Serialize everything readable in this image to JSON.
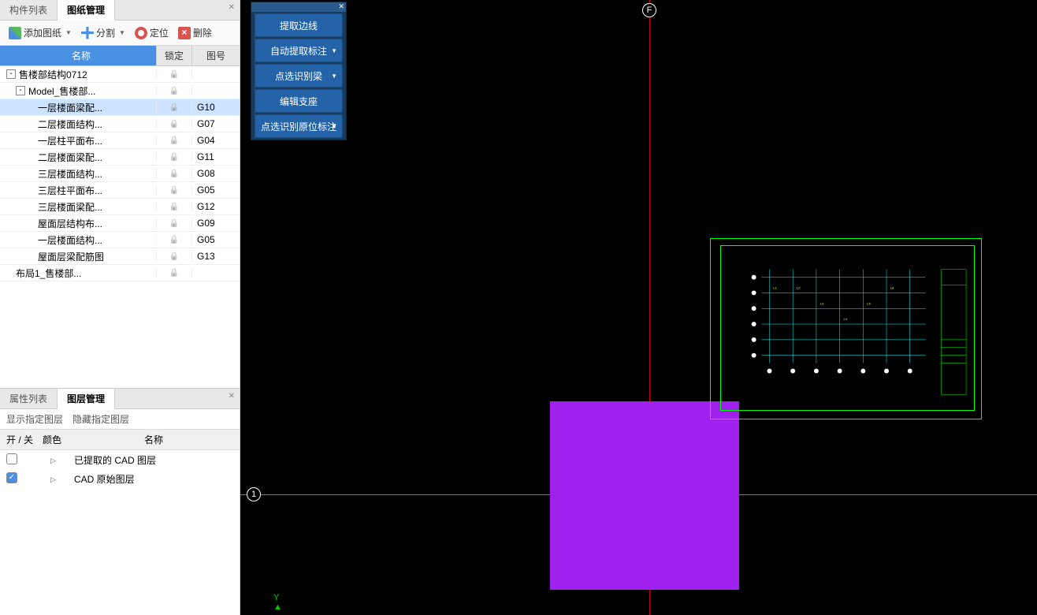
{
  "tabs_top": {
    "component_list": "构件列表",
    "drawing_mgmt": "图纸管理"
  },
  "toolbar_top": {
    "add_drawing": "添加图纸",
    "split": "分割",
    "locate": "定位",
    "delete": "删除"
  },
  "grid_header": {
    "name": "名称",
    "lock": "锁定",
    "num": "图号"
  },
  "tree": [
    {
      "indent": 0,
      "toggle": "-",
      "label": "售楼部结构0712",
      "lock": true,
      "num": "",
      "selected": false
    },
    {
      "indent": 1,
      "toggle": "-",
      "label": "Model_售楼部...",
      "lock": true,
      "num": "",
      "selected": false
    },
    {
      "indent": 2,
      "toggle": "",
      "label": "一层楼面梁配...",
      "lock": true,
      "num": "G10",
      "selected": true
    },
    {
      "indent": 2,
      "toggle": "",
      "label": "二层楼面结构...",
      "lock": true,
      "num": "G07",
      "selected": false
    },
    {
      "indent": 2,
      "toggle": "",
      "label": "一层柱平面布...",
      "lock": true,
      "num": "G04",
      "selected": false
    },
    {
      "indent": 2,
      "toggle": "",
      "label": "二层楼面梁配...",
      "lock": true,
      "num": "G11",
      "selected": false
    },
    {
      "indent": 2,
      "toggle": "",
      "label": "三层楼面结构...",
      "lock": true,
      "num": "G08",
      "selected": false
    },
    {
      "indent": 2,
      "toggle": "",
      "label": "三层柱平面布...",
      "lock": true,
      "num": "G05",
      "selected": false
    },
    {
      "indent": 2,
      "toggle": "",
      "label": "三层楼面梁配...",
      "lock": true,
      "num": "G12",
      "selected": false
    },
    {
      "indent": 2,
      "toggle": "",
      "label": "屋面层结构布...",
      "lock": true,
      "num": "G09",
      "selected": false
    },
    {
      "indent": 2,
      "toggle": "",
      "label": "一层楼面结构...",
      "lock": true,
      "num": "G05",
      "selected": false
    },
    {
      "indent": 2,
      "toggle": "",
      "label": "屋面层梁配筋图",
      "lock": true,
      "num": "G13",
      "selected": false
    },
    {
      "indent": 1,
      "toggle": "",
      "label": "布局1_售楼部...",
      "lock": true,
      "num": "",
      "selected": false
    }
  ],
  "tabs_bottom": {
    "attr_list": "属性列表",
    "layer_mgmt": "图层管理"
  },
  "subtabs": {
    "show": "显示指定图层",
    "hide": "隐藏指定图层"
  },
  "layer_header": {
    "onoff": "开 / 关",
    "color": "颜色",
    "name": "名称"
  },
  "layers": [
    {
      "checked": false,
      "name": "已提取的 CAD 图层"
    },
    {
      "checked": true,
      "name": "CAD 原始图层"
    }
  ],
  "float_buttons": {
    "b1": "提取边线",
    "b2": "自动提取标注",
    "b3": "点选识别梁",
    "b4": "编辑支座",
    "b5": "点选识别原位标注"
  },
  "axis": {
    "f": "F",
    "one": "1",
    "y": "Y"
  }
}
